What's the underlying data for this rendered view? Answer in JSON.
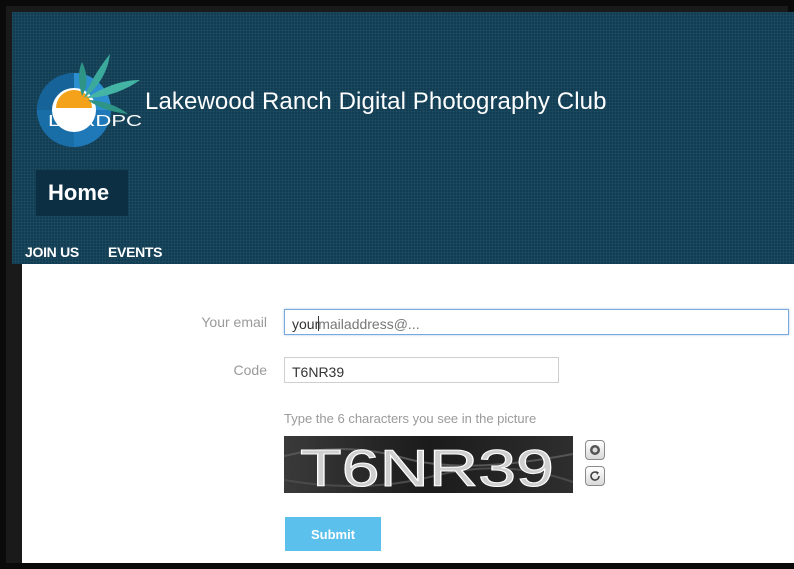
{
  "header": {
    "logo_text": "LWRDPC",
    "site_title": "Lakewood Ranch Digital Photography Club",
    "home_label": "Home",
    "nav": [
      "JOIN US",
      "EVENTS"
    ]
  },
  "form": {
    "email_label": "Your email",
    "email_typed": "your",
    "email_placeholder_rest": "mailaddress@...",
    "code_label": "Code",
    "code_value": "T6NR39",
    "captcha_hint": "Type the 6 characters you see in the picture",
    "captcha_text": "T6NR39",
    "submit_label": "Submit"
  },
  "icons": {
    "audio": "speaker-icon",
    "refresh": "refresh-icon"
  },
  "colors": {
    "header_bg": "#113e55",
    "submit_bg": "#5bc0ec"
  }
}
